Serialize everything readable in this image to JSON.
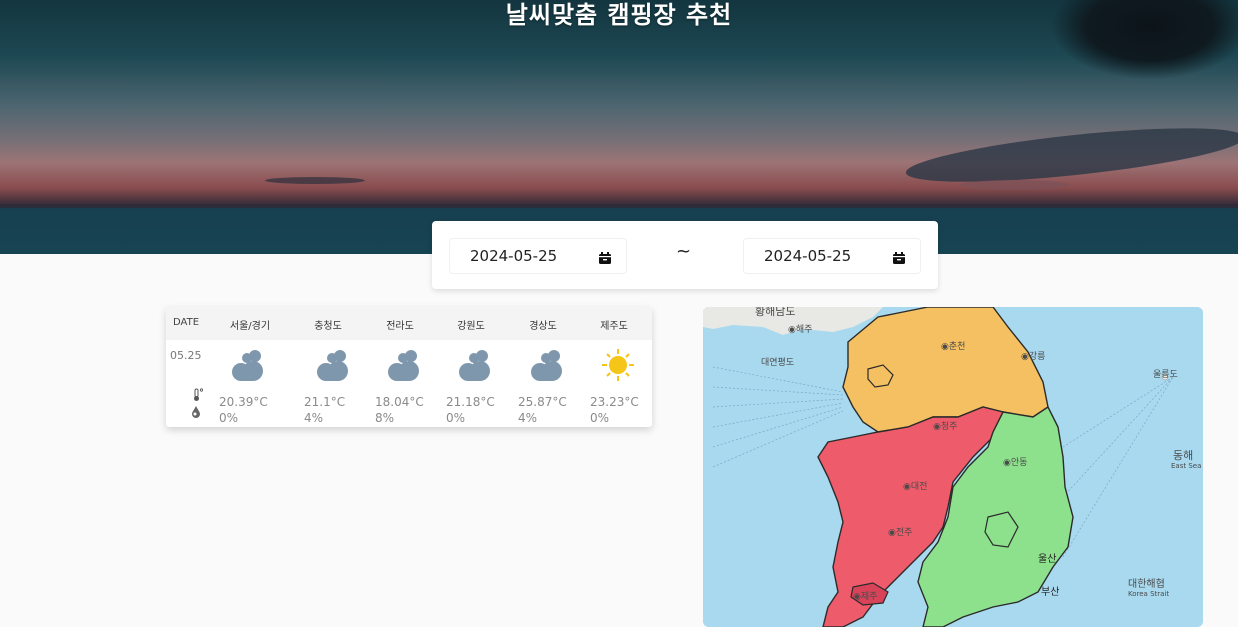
{
  "header": {
    "title": "날씨맞춤 캠핑장 추천"
  },
  "date_range": {
    "start": "2024-05-25",
    "separator": "~",
    "end": "2024-05-25"
  },
  "weather_table": {
    "date_header": "DATE",
    "date": "05.25",
    "regions": [
      {
        "name": "서울/경기",
        "icon": "cloudy-icon",
        "temp": "20.39°C",
        "rain": "0%"
      },
      {
        "name": "충청도",
        "icon": "cloudy-icon",
        "temp": "21.1°C",
        "rain": "4%"
      },
      {
        "name": "전라도",
        "icon": "cloudy-icon",
        "temp": "18.04°C",
        "rain": "8%"
      },
      {
        "name": "강원도",
        "icon": "cloudy-icon",
        "temp": "21.18°C",
        "rain": "0%"
      },
      {
        "name": "경상도",
        "icon": "cloudy-icon",
        "temp": "25.87°C",
        "rain": "4%"
      },
      {
        "name": "제주도",
        "icon": "sunny-icon",
        "temp": "23.23°C",
        "rain": "0%"
      }
    ]
  },
  "map": {
    "labels": {
      "hwanghae": "황해남도",
      "haeju": "◉해주",
      "yeonpyeong": "대연평도",
      "chuncheon": "◉춘천",
      "donghae": "동해",
      "east_sea": "East Sea",
      "ulleung": "울릉도",
      "korea_strait_ko": "대한해협",
      "korea_strait_en": "Korea Strait",
      "ulsan": "울산",
      "jeonju": "◉전주",
      "jeju": "◉제주",
      "andong": "◉안동",
      "cheongju": "◉청주",
      "daejeon": "◉대전",
      "gangneung": "◉강릉",
      "busan": "부산"
    },
    "colors": {
      "yellow_region": "#f5c061",
      "red_region": "#ee5b6a",
      "green_region": "#8ee18c",
      "sea": "#a8d9ef",
      "land": "#e8e8e4"
    }
  }
}
